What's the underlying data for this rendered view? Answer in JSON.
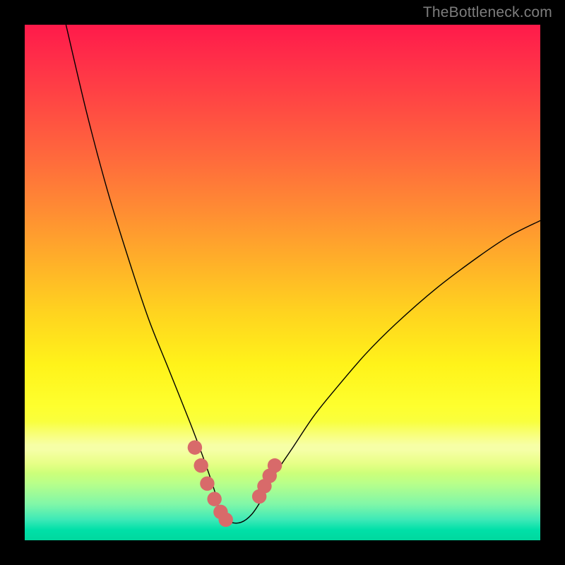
{
  "watermark": "TheBottleneck.com",
  "chart_data": {
    "type": "line",
    "title": "",
    "xlabel": "",
    "ylabel": "",
    "xlim": [
      0,
      100
    ],
    "ylim": [
      0,
      100
    ],
    "grid": false,
    "note": "V-shaped bottleneck curve on rainbow gradient; minimum plateau near x≈38–44 at y≈3–4; left branch rises to y≈100 at x≈8; right branch rises to y≈62 at x=100.",
    "series": [
      {
        "name": "bottleneck-curve",
        "x": [
          8,
          12,
          16,
          20,
          24,
          28,
          32,
          35,
          37,
          38,
          40,
          42,
          44,
          46,
          48,
          52,
          56,
          60,
          66,
          72,
          80,
          88,
          94,
          100
        ],
        "y": [
          100,
          83,
          68,
          55,
          43,
          33,
          23,
          15,
          9,
          5,
          3.5,
          3.5,
          5,
          8,
          12,
          18,
          24,
          29,
          36,
          42,
          49,
          55,
          59,
          62
        ]
      },
      {
        "name": "highlight-dots-left",
        "x": [
          33.0,
          34.2,
          35.4,
          36.8,
          38.0,
          39.0
        ],
        "y": [
          18.0,
          14.5,
          11.0,
          8.0,
          5.5,
          4.0
        ]
      },
      {
        "name": "highlight-dots-right",
        "x": [
          45.5,
          46.5,
          47.5,
          48.5
        ],
        "y": [
          8.5,
          10.5,
          12.5,
          14.5
        ]
      }
    ],
    "background_gradient_stops": [
      {
        "pos": 0.0,
        "color": "#ff1a4a"
      },
      {
        "pos": 0.14,
        "color": "#ff4444"
      },
      {
        "pos": 0.36,
        "color": "#ff8c33"
      },
      {
        "pos": 0.56,
        "color": "#ffd41f"
      },
      {
        "pos": 0.74,
        "color": "#feff2e"
      },
      {
        "pos": 0.89,
        "color": "#b8ff8a"
      },
      {
        "pos": 1.0,
        "color": "#00d89e"
      }
    ]
  }
}
